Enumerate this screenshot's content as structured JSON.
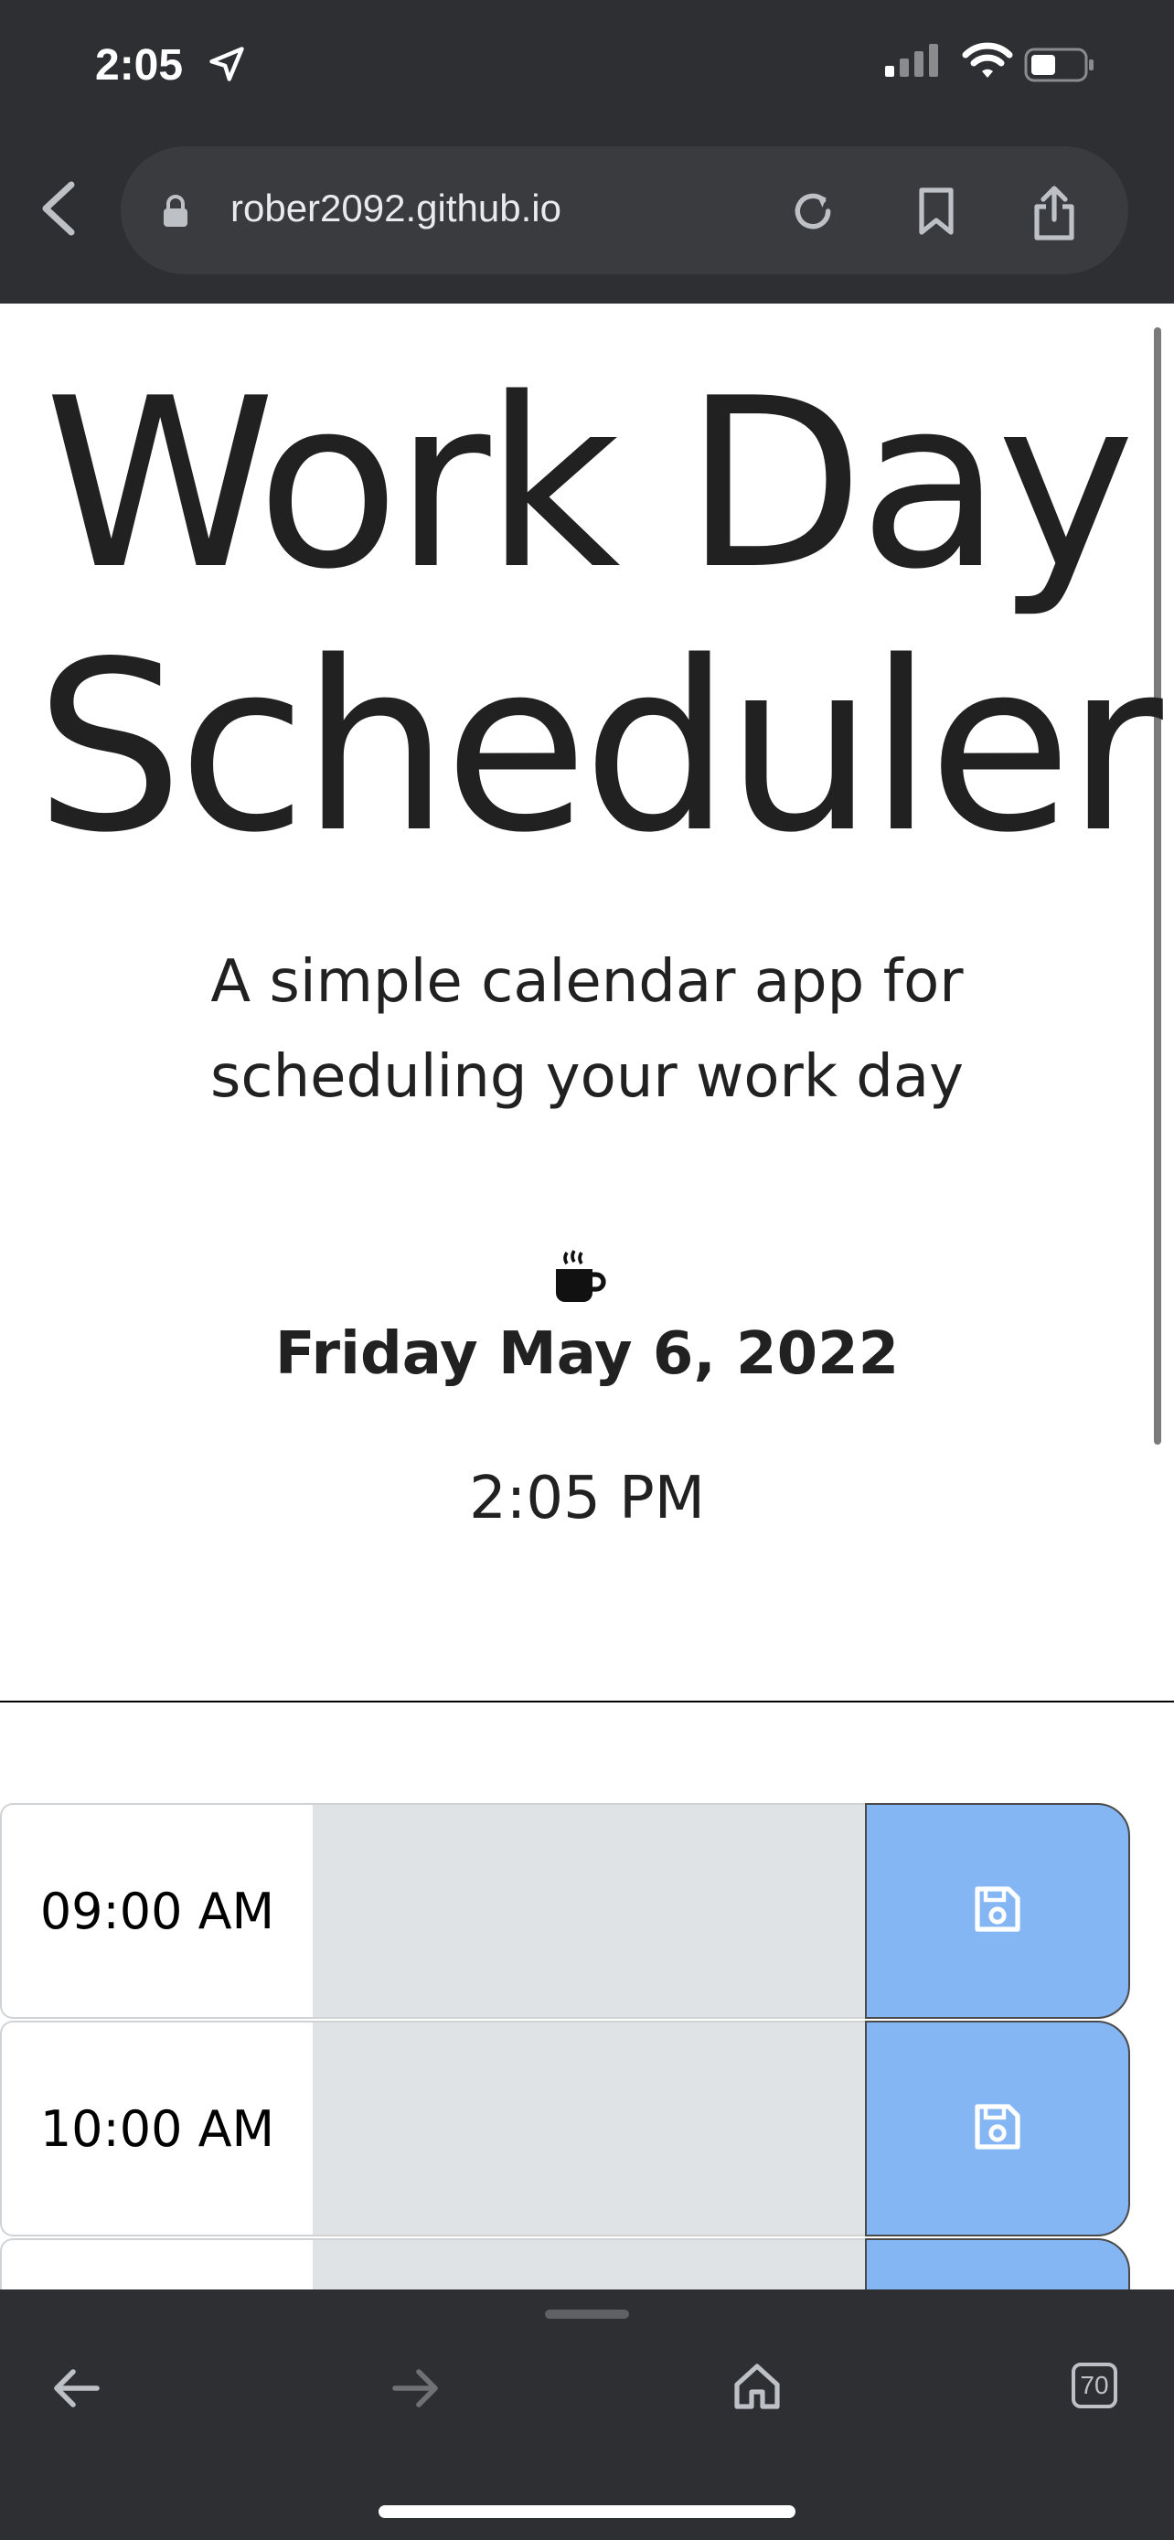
{
  "status_bar": {
    "time": "2:05"
  },
  "browser": {
    "url": "rober2092.github.io",
    "tab_count": "70"
  },
  "header": {
    "title_line1": "Work Day",
    "title_line2": "Scheduler",
    "lead_line1": "A simple calendar app for",
    "lead_line2": "scheduling your work day",
    "icon": "coffee-cup-icon",
    "date": "Friday May 6, 2022",
    "time": "2:05 PM"
  },
  "schedule": {
    "rows": [
      {
        "hour": "09:00 AM",
        "text": ""
      },
      {
        "hour": "10:00 AM",
        "text": ""
      },
      {
        "hour": "",
        "text": ""
      }
    ]
  },
  "colors": {
    "past": "#dfe3e6",
    "save_button": "#85b6f4",
    "chrome": "#2e2f32"
  }
}
